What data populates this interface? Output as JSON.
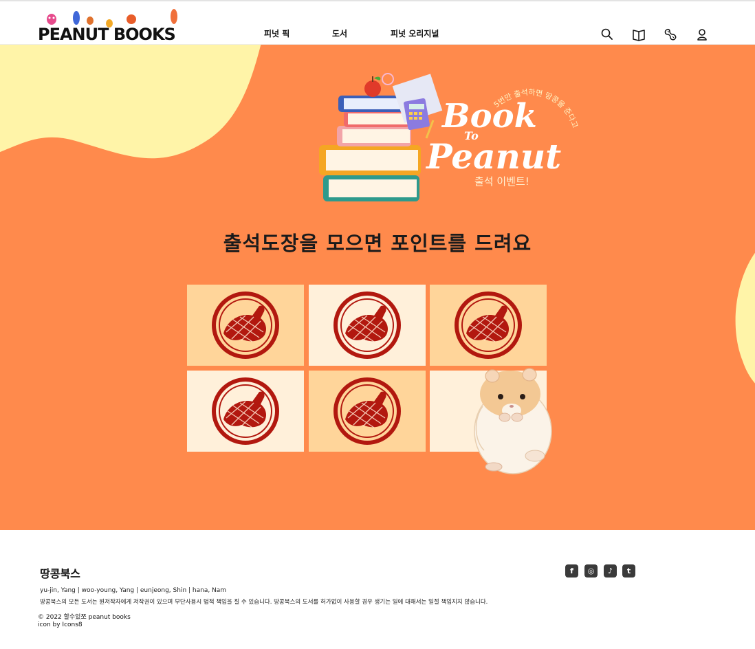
{
  "header": {
    "logo_text": "PEANUT BOOKS",
    "nav": [
      {
        "label": "피넛 픽"
      },
      {
        "label": "도서"
      },
      {
        "label": "피넛 오리지널"
      }
    ],
    "icons": [
      "search-icon",
      "book-icon",
      "peanut-icon",
      "user-icon"
    ]
  },
  "hero": {
    "banner": {
      "title_line1": "Book",
      "title_to": "To",
      "title_line2": "Peanut",
      "arc_text": "5번만 출석하면 땅콩을 준다고?",
      "subtitle": "출석 이벤트!"
    },
    "headline": "출석도장을 모으면 포인트를 드려요",
    "stamps": {
      "total": 6,
      "collected": 5
    }
  },
  "footer": {
    "title": "땅콩북스",
    "credits": "yu-jin, Yang  |  woo-young, Yang  |  eunjeong, Shin  |  hana, Nam",
    "notice": "땅콩북스의 모든 도서는 원저작자에게 저작권이 있으며 무단사용시 법적 책임을 질 수 있습니다. 땅콩북스의 도서를 허가없이 사용할 경우 생기는 일에 대해서는 일절 책임지지 않습니다.",
    "copyright": "© 2022 할수있쪼 peanut books",
    "icon_credit": "icon by Icons8",
    "social": [
      "facebook-icon",
      "instagram-icon",
      "tiktok-icon",
      "twitter-icon"
    ]
  },
  "colors": {
    "hero_bg": "#ff8a4c",
    "blob": "#fff4a8",
    "cell_dark": "#ffd59a",
    "cell_light": "#fff0da",
    "stamp": "#b2180f"
  }
}
